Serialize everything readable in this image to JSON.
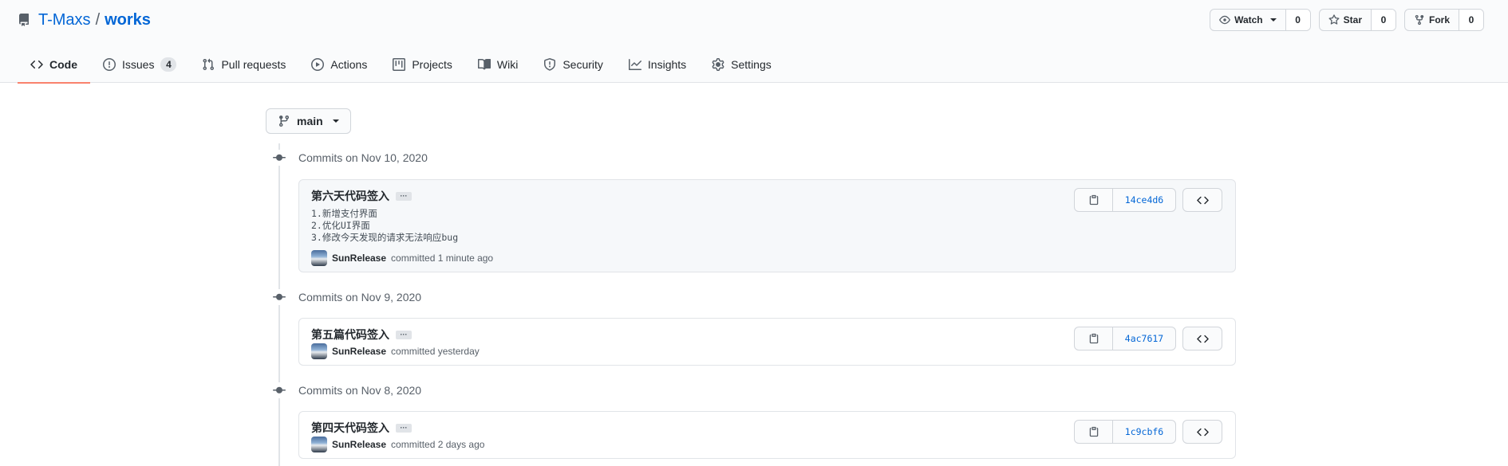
{
  "repo": {
    "owner": "T-Maxs",
    "separator": "/",
    "name": "works"
  },
  "actions": {
    "watch": {
      "label": "Watch",
      "count": "0"
    },
    "star": {
      "label": "Star",
      "count": "0"
    },
    "fork": {
      "label": "Fork",
      "count": "0"
    }
  },
  "tabs": [
    {
      "label": "Code",
      "icon": "code-icon",
      "selected": true
    },
    {
      "label": "Issues",
      "icon": "issue-opened-icon",
      "count": "4"
    },
    {
      "label": "Pull requests",
      "icon": "git-pull-request-icon"
    },
    {
      "label": "Actions",
      "icon": "play-icon"
    },
    {
      "label": "Projects",
      "icon": "project-icon"
    },
    {
      "label": "Wiki",
      "icon": "book-icon"
    },
    {
      "label": "Security",
      "icon": "shield-icon"
    },
    {
      "label": "Insights",
      "icon": "graph-icon"
    },
    {
      "label": "Settings",
      "icon": "gear-icon"
    }
  ],
  "branch": {
    "label": "main"
  },
  "commit_groups": [
    {
      "date_label": "Commits on Nov 10, 2020",
      "commits": [
        {
          "title": "第六天代码签入",
          "description": "1.新增支付界面\n2.优化UI界面\n3.修改今天发现的请求无法响应bug",
          "author": "SunRelease",
          "committed_text": "committed 1 minute ago",
          "sha": "14ce4d6"
        }
      ]
    },
    {
      "date_label": "Commits on Nov 9, 2020",
      "commits": [
        {
          "title": "第五篇代码签入",
          "author": "SunRelease",
          "committed_text": "committed yesterday",
          "sha": "4ac7617"
        }
      ]
    },
    {
      "date_label": "Commits on Nov 8, 2020",
      "commits": [
        {
          "title": "第四天代码签入",
          "author": "SunRelease",
          "committed_text": "committed 2 days ago",
          "sha": "1c9cbf6"
        }
      ]
    }
  ],
  "colors": {
    "link": "#0366d6",
    "tab_underline": "#f9826c",
    "border": "#e1e4e8"
  }
}
